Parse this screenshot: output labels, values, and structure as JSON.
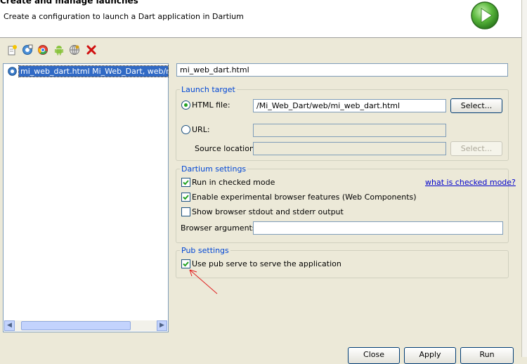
{
  "header": {
    "title": "Create and manage launches",
    "subtitle": "Create a configuration to launch a Dart application in Dartium",
    "icon": "run-launch-icon"
  },
  "toolbar": {
    "icons": [
      "new-launch-config-icon",
      "duplicate-icon",
      "new-chrome-app-icon",
      "android-icon",
      "web-launch-icon",
      "delete-icon"
    ]
  },
  "launch_list": {
    "items": [
      {
        "label": "mi_web_dart.html Mi_Web_Dart, web/mi_web_dart.html",
        "icon": "dartium-launch-icon",
        "selected": true
      }
    ]
  },
  "config_name": "mi_web_dart.html",
  "launch_target": {
    "group_label": "Launch target",
    "html_file_label": "HTML file:",
    "html_file_value": "/Mi_Web_Dart/web/mi_web_dart.html",
    "html_selected": true,
    "select_label": "Select...",
    "url_label": "URL:",
    "url_value": "",
    "source_location_label": "Source location:",
    "source_location_value": "",
    "source_select_label": "Select..."
  },
  "dartium_settings": {
    "group_label": "Dartium settings",
    "checked_mode_label": "Run in checked mode",
    "checked_mode": true,
    "checked_mode_link": "what is checked mode?",
    "experimental_label": "Enable experimental browser features (Web Components)",
    "experimental": true,
    "stdout_label": "Show browser stdout and stderr output",
    "stdout": false,
    "browser_args_label": "Browser arguments:",
    "browser_args_value": ""
  },
  "pub_settings": {
    "group_label": "Pub settings",
    "pub_serve_label": "Use pub serve to serve the application",
    "pub_serve": true
  },
  "footer": {
    "close_label": "Close",
    "apply_label": "Apply",
    "run_label": "Run"
  },
  "colors": {
    "accent": "#316ac5",
    "group_label": "#0046d5",
    "annotation_arrow": "#e02020"
  }
}
